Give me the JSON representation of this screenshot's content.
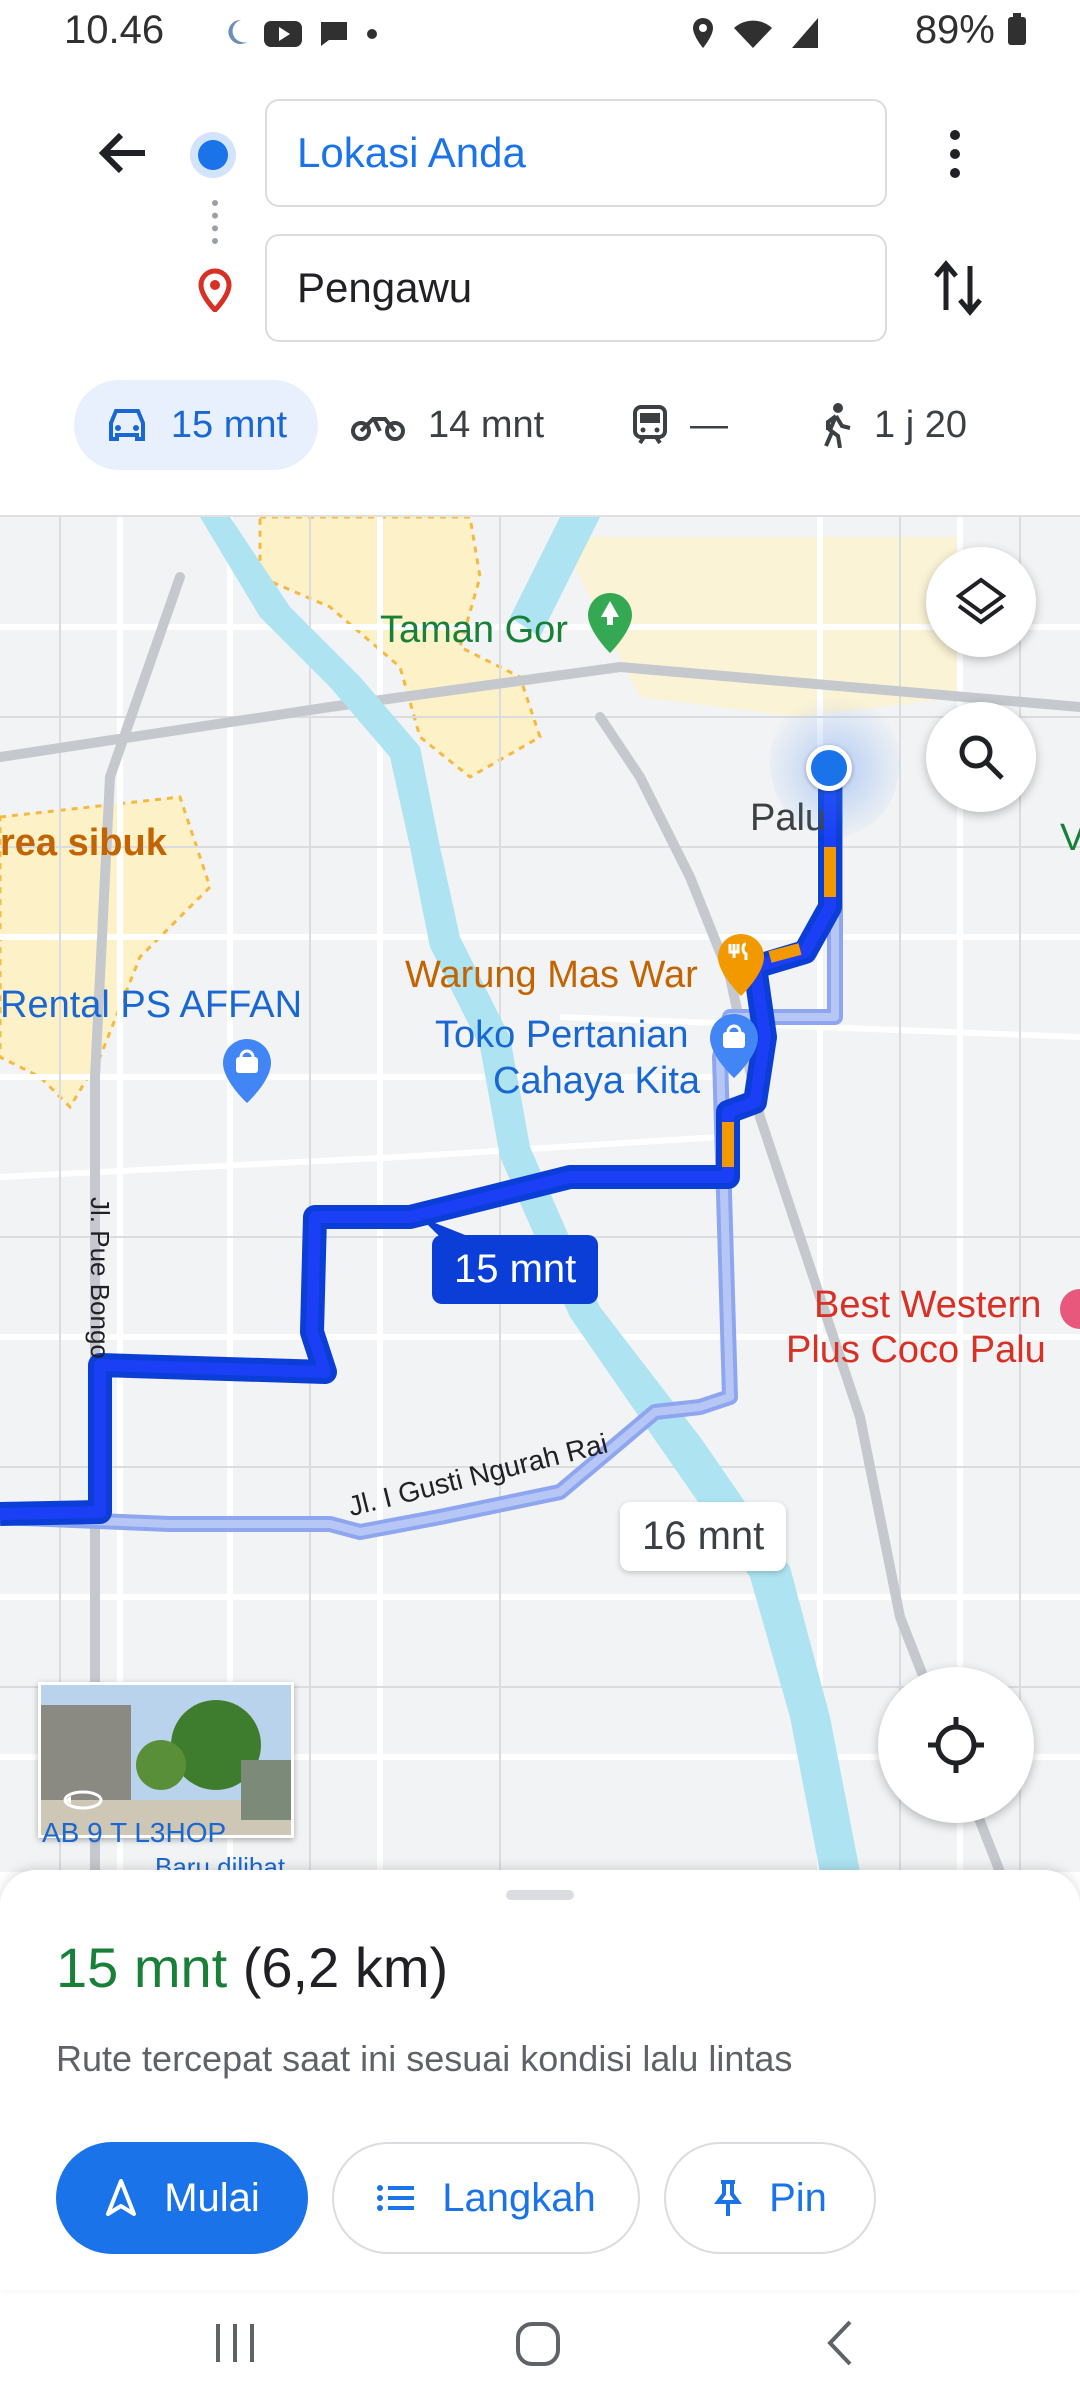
{
  "status_bar": {
    "time": "10.46",
    "battery": "89%"
  },
  "search": {
    "origin": "Lokasi Anda",
    "destination": "Pengawu"
  },
  "modes": [
    {
      "icon": "car-icon",
      "label": "15 mnt"
    },
    {
      "icon": "motorcycle-icon",
      "label": "14 mnt"
    },
    {
      "icon": "transit-icon",
      "label": "—"
    },
    {
      "icon": "walk-icon",
      "label": "1 j 20"
    }
  ],
  "map": {
    "labels": {
      "taman_gor": "Taman Gor",
      "palu": "Palu",
      "area_sibuk": "rea sibuk",
      "warung": "Warung Mas War",
      "rental": "Rental PS AFFAN",
      "toko1": "Toko Pertanian",
      "toko2": "Cahaya Kita",
      "best_western1": "Best Western",
      "best_western2": "Plus Coco Palu",
      "jl_pue_bongo": "Jl. Pue Bongo",
      "jl_gusti": "Jl. I Gusti Ngurah Rai",
      "edge_v": "V",
      "thumb_text1": "AB 9 T L3HOP",
      "thumb_text2": "Baru dilihat"
    },
    "route_main_label": "15 mnt",
    "route_alt_label": "16 mnt"
  },
  "sheet": {
    "time": "15 mnt",
    "distance": "(6,2 km)",
    "description": "Rute tercepat saat ini sesuai kondisi lalu lintas",
    "buttons": {
      "start": "Mulai",
      "steps": "Langkah",
      "pin": "Pin"
    }
  },
  "colors": {
    "accent": "#1a73e8",
    "route": "#0b3ed6",
    "traffic": "#f29900",
    "time_green": "#188038"
  }
}
